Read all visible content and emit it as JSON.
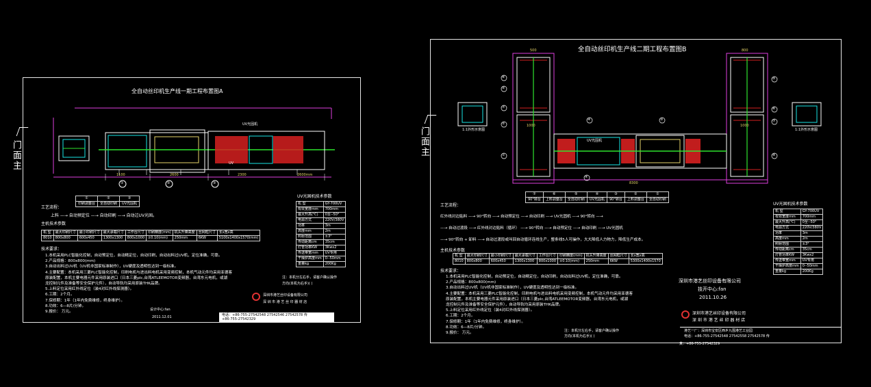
{
  "door_label_left": "门面主",
  "door_label_right": "门面主",
  "sheet_a": {
    "title": "全自动丝印机生产线一期工程布置图A",
    "uv_label": "UV",
    "uv_label2": "UV光固机",
    "dims": [
      "1100",
      "2600",
      "2300",
      "2600mm"
    ],
    "numbers": [
      "①",
      "②",
      "③"
    ],
    "legend_nums": [
      "①",
      "②",
      "③"
    ],
    "legend_names": [
      "印刷调整台",
      "全自动印刷",
      "UV光固机"
    ],
    "process_title": "工艺流程：",
    "process_text": "上料 —→ 自动预定位 —→ 自动印刷 —→ 自动过UV光固。",
    "main_params_title": "主机技术参数",
    "main_table_head": [
      "机  型",
      "最大印刷尺寸",
      "最小印刷尺寸",
      "最大承载尺寸",
      "工作台尺寸",
      "印刷精度(mm)",
      "机头升降高度",
      "丝网框尺寸",
      "长x宽x高"
    ],
    "main_table_row": [
      "8010",
      "800x800",
      "600x450",
      "1300x1300",
      "800x1000",
      "±0.10(mm)",
      "250mm",
      "6KW",
      "5100x1400x1570(mm)"
    ],
    "tech_title": "技术要求：",
    "tech_items": [
      "1.本机采用PLC智能化控制，自动预定位，自动精定位，自动印刷，自动出料过UV机，定位准确，可靠。",
      "2.产品规格：800x800(mm)",
      "3.自动出料过UV机（UV机非国家标准制作），UV硬度及透明性达到一级标准。",
      "4.主要配置：本机采用三菱PLC智能化控制，印刷电机与进出料电机采用变频控制，本机气动元件均采用亚德客",
      "   原装配置，本机主要电器元件采用原装进口（日本三菱plc,台湾ATLEEMOTOR变频器，台湾东元电机，或湖",
      "   龙控制元件及准备等安全保护元件），自动导轨均采用原装THK品牌。",
      "5.上料定位采用红外线定位（装4对红外线探测器）。",
      "6.工期：2个月。",
      "7.保修期：1年（1年内免费维修，终身维护）。",
      "8.功效：6—8片/分钟。",
      "9.报价：      万元。"
    ],
    "uv_params_title": "UV光固机技术参数",
    "uv_params": [
      [
        "机  型",
        "GY-700UV"
      ],
      [
        "有效宽度mm",
        "700mm"
      ],
      [
        "最大升高(℃)",
        "0至--50°"
      ],
      [
        "电源方式",
        "220V/380V"
      ],
      [
        "功率",
        "3m"
      ],
      [
        "高度mm",
        "2m"
      ],
      [
        "照射范围",
        "±3°"
      ],
      [
        "传动距离cm",
        "35cm"
      ],
      [
        "灯管功率KW",
        "3Kwx2"
      ],
      [
        "传送带宽mm",
        "UV专用"
      ],
      [
        "干燥炉高度mm",
        "0--50mm"
      ],
      [
        "重量kg",
        "200Kg"
      ]
    ],
    "note": "注：本机分左右手，请客户确认操作",
    "note2": "方向(本机为右手)(  )",
    "company": "深圳市港艺丝印设备有限公司",
    "company_sub": "深 圳 市 港 艺 丝 印 器 材 店",
    "designer": "设计中心:fan",
    "date": "2011.12.01",
    "contact1": "电话：+86-755-27542548  27542546  27542578 传",
    "contact2": "+86-755-27542329"
  },
  "sheet_b": {
    "title": "全自动丝印机生产线二期工程布置图B",
    "side_note": "1:1外形示意图",
    "side_note_r": "1:1外形示意图",
    "dims": [
      "500",
      "1000",
      "1000",
      "800",
      "8300"
    ],
    "callouts": [
      "⑥",
      "⑤",
      "⑦",
      "④",
      "③",
      "②",
      "①",
      "④",
      "⑤",
      "⑥",
      "⑦",
      "⑧"
    ],
    "uv_label": "UV光固机",
    "legend_nums": [
      "⑦",
      "⑥",
      "⑤",
      "④",
      "③",
      "②",
      "①"
    ],
    "legend_names": [
      "90°转台",
      "上料调整台",
      "全自动印刷",
      "UV光固机",
      "90°转台",
      "上料调整台",
      "全自动印刷"
    ],
    "process_title": "工艺流程：",
    "process_lines": [
      "红外线对边贴料 —→ 90°转向 —→ 自动预定位 —→ 自动印刷 —→ UV光固机 —→ 90°转向 —→",
      "—→ 自动过渡段 —→ 红外线对边贴料（循环） —→ 90°转向 —→ 自动预定位 —→ 自动印刷 —→ UV光固机",
      "—→ 90°转向 + 卸料 —→ 自动过渡段或叫回自动循环连线生产，整条线5人可操作，大大降低人力物力，降低生产成本。"
    ],
    "main_params_title": "主机技术参数",
    "main_table_head": [
      "机  型",
      "最大印刷尺寸",
      "最小印刷尺寸",
      "最大承载尺寸",
      "工作台尺寸",
      "印刷精度(mm)",
      "机头升降高度",
      "丝网框尺寸",
      "长x宽x高"
    ],
    "main_table_row": [
      "8010",
      "800x800",
      "600x450",
      "1300x1300",
      "800x1000",
      "±0.10(mm)",
      "250mm",
      "6KW",
      "5300x1400x1570"
    ],
    "tech_title": "技术要求：",
    "tech_items": [
      "1.本机采用PLC智能化控制，自动预定位，自动精定位，自动印刷，自动出料过UV机，定位准确，可靠。",
      "2.产品规格：800x800(mm)",
      "3.自动出料过UV机（UV机非国家标准制作），UV硬度及透明性达到一级标准。",
      "4.主要配置：本机采用三菱PLC智能化控制，印刷电机与进出料电机采用变频控制，本机气动元件均采用亚德客",
      "   原装配置，本机主要电器元件采用原装进口（日本三菱plc,台湾ATLEEMOTOR变频器，台湾东元电机，或湖",
      "   龙控制元件及准备等安全保护元件），自动导轨均采用原装THK品牌。",
      "5.上料定位采用红外线定位（装4对红外线探测器）。",
      "6.工期：2个月。",
      "7.保修期：1年（1年内免费维修，终身维护）。",
      "8.功效：6—8片/分钟。",
      "9.报价：      万元。"
    ],
    "uv_params_title": "UV光固机技术参数",
    "uv_params": [
      [
        "机  型",
        "GY-700UV"
      ],
      [
        "有效宽度mm",
        "700mm"
      ],
      [
        "最大升高(℃)",
        "0至--50°"
      ],
      [
        "电源方式",
        "220V/380V"
      ],
      [
        "功率",
        "3m"
      ],
      [
        "高度mm",
        "2m"
      ],
      [
        "照射范围",
        "±3°"
      ],
      [
        "传动距离cm",
        "35cm"
      ],
      [
        "灯管功率KW",
        "3Kwx2"
      ],
      [
        "传送带宽mm",
        "UV专用"
      ],
      [
        "干燥炉高度mm",
        "0--50mm"
      ],
      [
        "重量kg",
        "200Kg"
      ]
    ],
    "company_center": "深圳市港艺丝印设备有限公司",
    "designer": "技开中心:fan",
    "date": "2011.10.26",
    "company": "深圳市港艺丝印设备有限公司",
    "company_sub": "深 圳 市 港 艺 丝 印 器 材 店",
    "addr": "港艺一厂：深圳市宝安区西乡九围港艺工业园",
    "contact1": "电话：+86-755-27542548  27542558  27542578  传",
    "contact2": "真：+86-755-27542329",
    "note": "注：本机分左右手，请客户确认操作",
    "note2": "方向(本机为右手)(  )"
  }
}
